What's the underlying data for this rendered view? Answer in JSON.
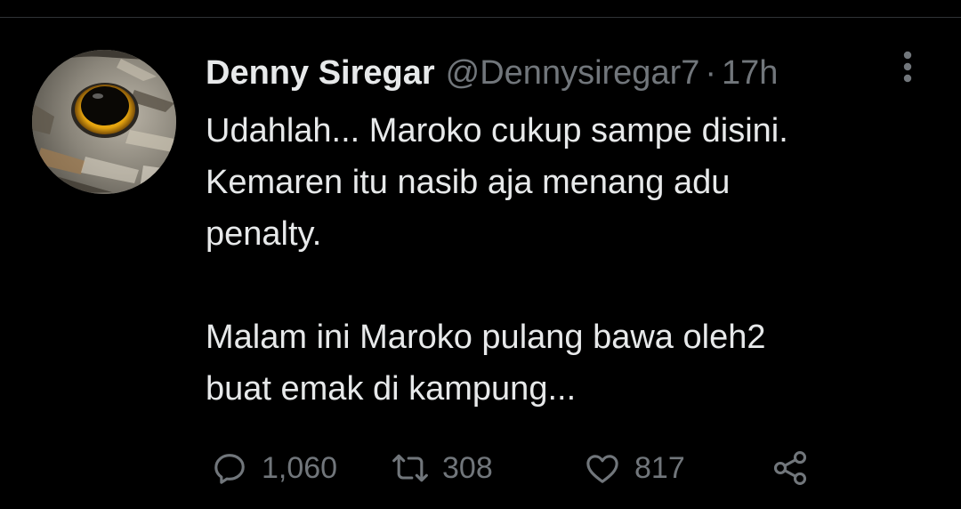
{
  "tweet": {
    "author_name": "Denny Siregar",
    "handle": "@Dennysiregar7",
    "separator": "·",
    "time": "17h",
    "text": "Udahlah... Maroko cukup sampe disini.\nKemaren itu nasib aja menang adu\npenalty.\n\nMalam ini Maroko pulang bawa oleh2\nbuat emak di kampung...",
    "avatar_description": "owl-eye-avatar"
  },
  "actions": {
    "reply_count": "1,060",
    "retweet_count": "308",
    "like_count": "817",
    "reply_icon": "reply-icon",
    "retweet_icon": "retweet-icon",
    "like_icon": "heart-icon",
    "share_icon": "share-icon"
  },
  "colors": {
    "background": "#000000",
    "text_primary": "#e7e9ea",
    "text_secondary": "#71767b",
    "divider": "#2f3336"
  }
}
